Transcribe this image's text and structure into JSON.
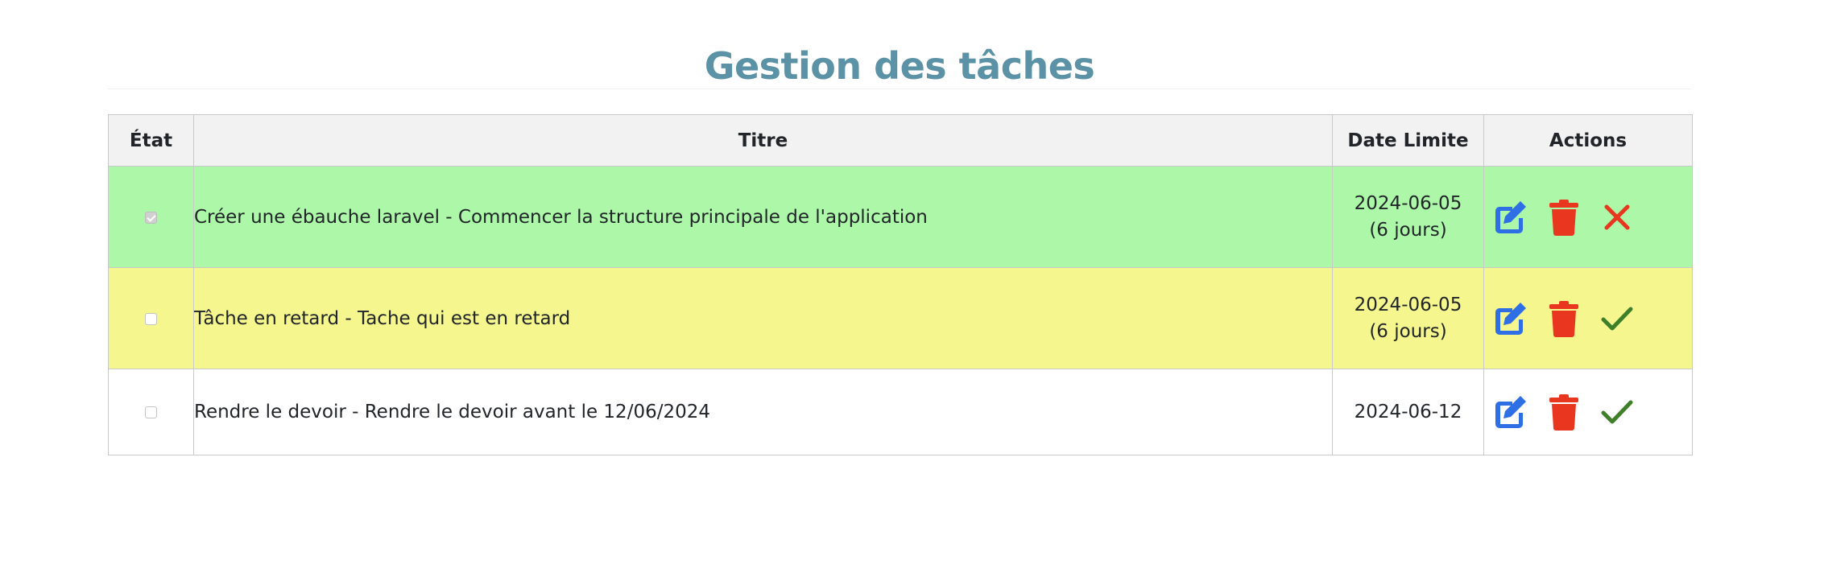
{
  "page": {
    "title": "Gestion des tâches"
  },
  "table": {
    "headers": {
      "etat": "État",
      "titre": "Titre",
      "date": "Date Limite",
      "actions": "Actions"
    },
    "rows": [
      {
        "status": "done",
        "checked": true,
        "title": "Créer une ébauche laravel - Commencer la structure principale de l'application",
        "date": "2024-06-05",
        "remaining": "(6 jours)",
        "toggle_icon": "x-icon"
      },
      {
        "status": "late",
        "checked": false,
        "title": "Tâche en retard - Tache qui est en retard",
        "date": "2024-06-05",
        "remaining": "(6 jours)",
        "toggle_icon": "check-icon"
      },
      {
        "status": "normal",
        "checked": false,
        "title": "Rendre le devoir - Rendre le devoir avant le 12/06/2024",
        "date": "2024-06-12",
        "remaining": "",
        "toggle_icon": "check-icon"
      }
    ]
  },
  "colors": {
    "title": "#5b92a6",
    "row_done": "#acf8a8",
    "row_late": "#f5f78e",
    "edit_icon": "#2f6fe6",
    "delete_icon": "#e8361f",
    "uncomplete_icon": "#e8361f",
    "complete_icon": "#3f7f2a"
  }
}
